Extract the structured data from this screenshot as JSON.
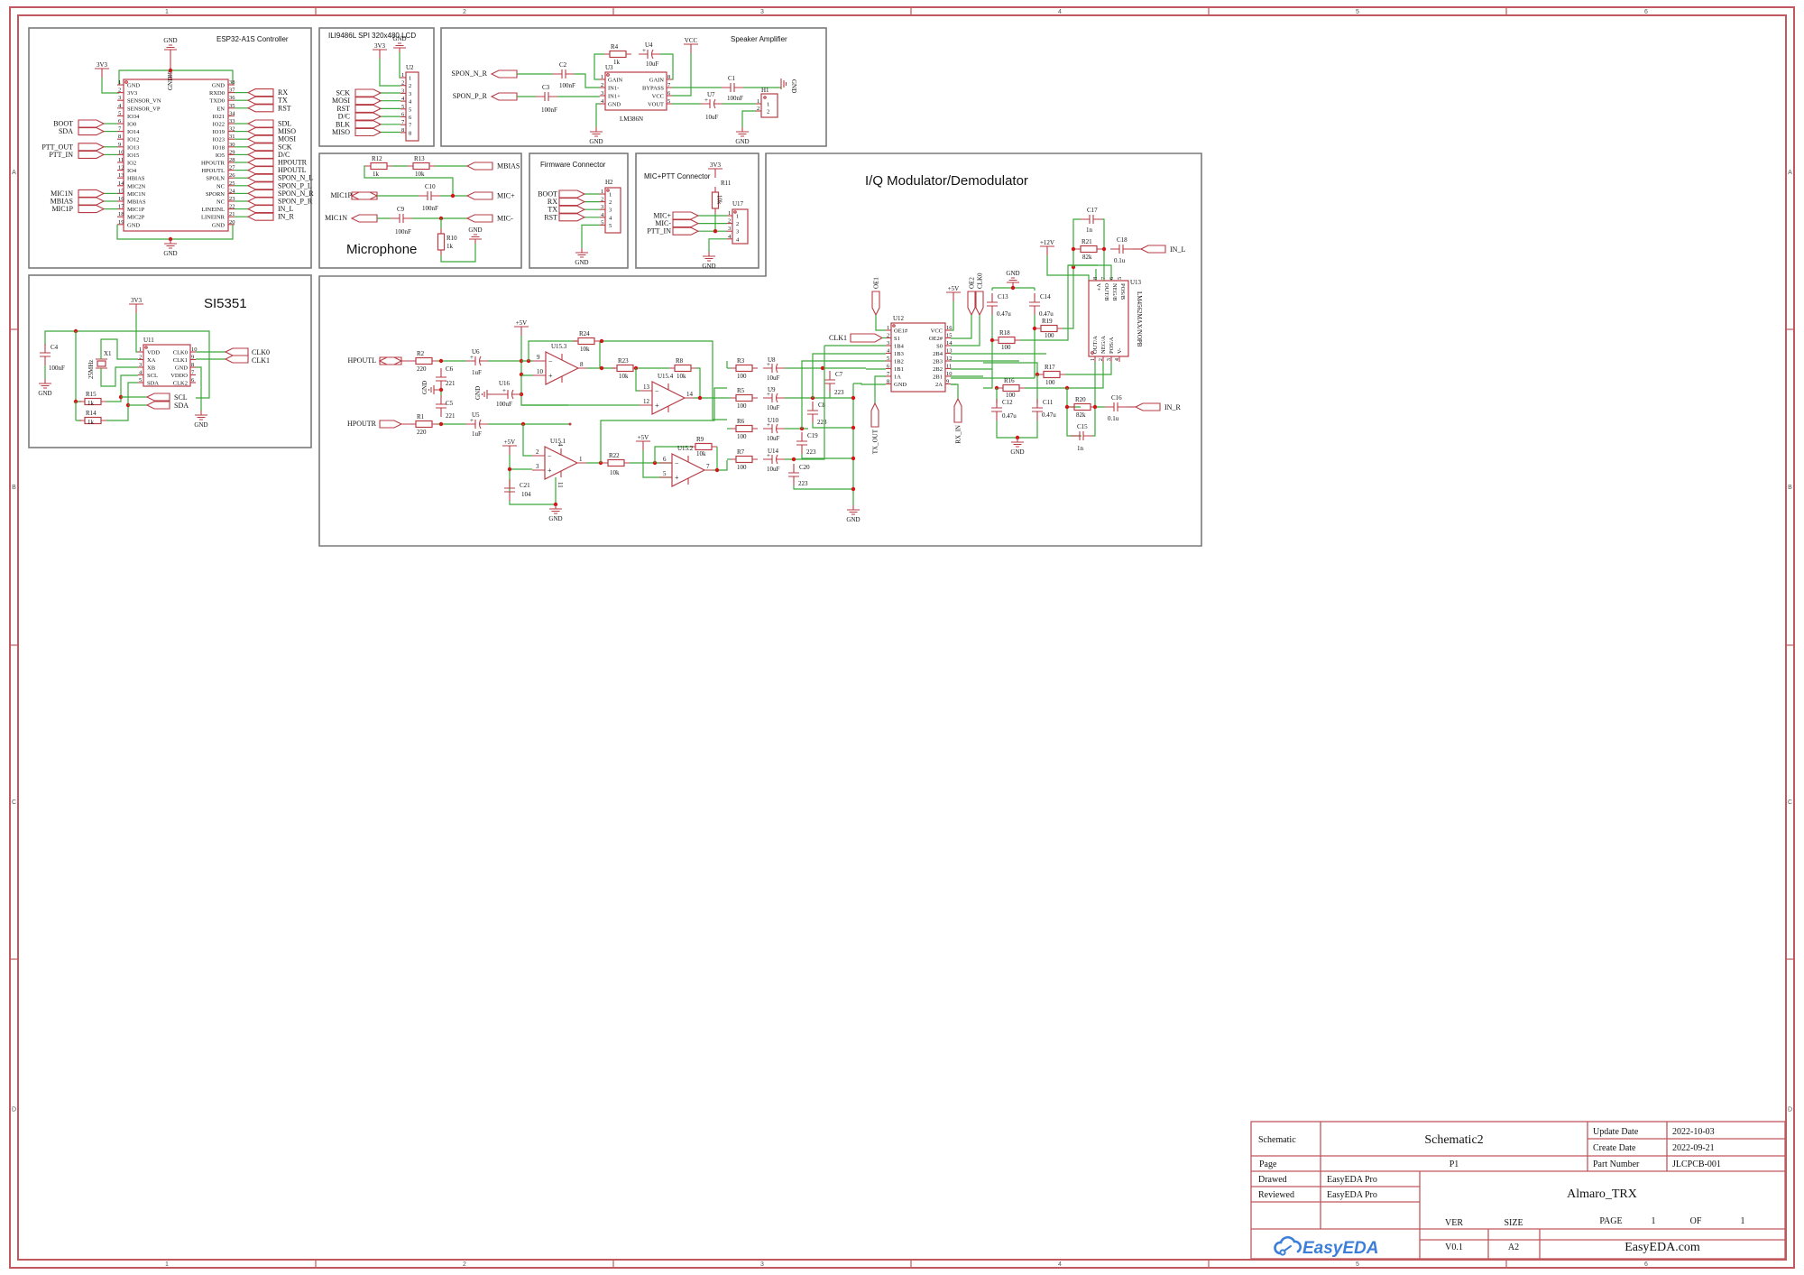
{
  "grid": {
    "columns": [
      "1",
      "2",
      "3",
      "4",
      "5",
      "6"
    ],
    "rows": [
      "A",
      "B",
      "C",
      "D"
    ]
  },
  "colors": {
    "wire": "#3aa83a",
    "component": "#b83c44",
    "junction": "#d01818",
    "frame": "#c0585d",
    "region_border": "#7a7a7a",
    "logo": "#3d7fd8"
  },
  "esp32": {
    "title": "ESP32-A1S Controller",
    "power_3v3": "3V3",
    "gnd_top": "GND",
    "gnd_bottom": "GND",
    "top_pin": {
      "num": "39",
      "name": "GND"
    },
    "left_pins": [
      {
        "num": "1",
        "name": "GND",
        "net": ""
      },
      {
        "num": "2",
        "name": "3V3",
        "net": ""
      },
      {
        "num": "3",
        "name": "SENSOR_VN",
        "net": ""
      },
      {
        "num": "4",
        "name": "SENSOR_VP",
        "net": ""
      },
      {
        "num": "5",
        "name": "IO34",
        "net": ""
      },
      {
        "num": "6",
        "name": "IO0",
        "net": "BOOT"
      },
      {
        "num": "7",
        "name": "IO14",
        "net": "SDA"
      },
      {
        "num": "8",
        "name": "IO12",
        "net": ""
      },
      {
        "num": "9",
        "name": "IO13",
        "net": "PTT_OUT"
      },
      {
        "num": "10",
        "name": "IO15",
        "net": "PTT_IN"
      },
      {
        "num": "11",
        "name": "IO2",
        "net": ""
      },
      {
        "num": "12",
        "name": "IO4",
        "net": ""
      },
      {
        "num": "13",
        "name": "HBIAS",
        "net": ""
      },
      {
        "num": "14",
        "name": "MIC2N",
        "net": ""
      },
      {
        "num": "15",
        "name": "MIC1N",
        "net": "MIC1N"
      },
      {
        "num": "16",
        "name": "MBIAS",
        "net": "MBIAS"
      },
      {
        "num": "17",
        "name": "MIC1P",
        "net": "MIC1P"
      },
      {
        "num": "18",
        "name": "MIC2P",
        "net": ""
      },
      {
        "num": "19",
        "name": "GND",
        "net": ""
      }
    ],
    "right_pins": [
      {
        "num": "38",
        "name": "GND",
        "net": ""
      },
      {
        "num": "37",
        "name": "RXD0",
        "net": "RX"
      },
      {
        "num": "36",
        "name": "TXD0",
        "net": "TX"
      },
      {
        "num": "35",
        "name": "EN",
        "net": "RST"
      },
      {
        "num": "34",
        "name": "IO21",
        "net": ""
      },
      {
        "num": "33",
        "name": "IO22",
        "net": "SDL"
      },
      {
        "num": "32",
        "name": "IO19",
        "net": "MISO"
      },
      {
        "num": "31",
        "name": "IO23",
        "net": "MOSI"
      },
      {
        "num": "30",
        "name": "IO18",
        "net": "SCK"
      },
      {
        "num": "29",
        "name": "IO5",
        "net": "D/C"
      },
      {
        "num": "28",
        "name": "HPOUTR",
        "net": "HPOUTR"
      },
      {
        "num": "27",
        "name": "HPOUTL",
        "net": "HPOUTL"
      },
      {
        "num": "26",
        "name": "SPOLN",
        "net": "SPON_N_L"
      },
      {
        "num": "25",
        "name": "NC",
        "net": "SPON_P_L"
      },
      {
        "num": "24",
        "name": "SPORN",
        "net": "SPON_N_R"
      },
      {
        "num": "23",
        "name": "NC",
        "net": "SPON_P_R"
      },
      {
        "num": "22",
        "name": "LINEINL",
        "net": "IN_L"
      },
      {
        "num": "21",
        "name": "LINEINR",
        "net": "IN_R"
      },
      {
        "num": "20",
        "name": "GND",
        "net": ""
      }
    ]
  },
  "lcd": {
    "title": "ILI9486L SPI 320x480 LCD",
    "power_3v3": "3V3",
    "gnd": "GND",
    "designator": "U2",
    "pins": [
      "1",
      "2",
      "3",
      "4",
      "5",
      "6",
      "7",
      "8"
    ],
    "nets": [
      "SCK",
      "MOSI",
      "RST",
      "D/C",
      "BLK",
      "MISO"
    ]
  },
  "speaker": {
    "title": "Speaker Amplifier",
    "vcc": "VCC",
    "gnd_right": "GND",
    "gnd_left": "GND",
    "gnd_h1": "GND",
    "in_n": "SPON_N_R",
    "in_p": "SPON_P_R",
    "r4": {
      "ref": "R4",
      "value": "1k"
    },
    "u4": {
      "ref": "U4",
      "value": "10uF"
    },
    "c2": {
      "ref": "C2",
      "value": "100nF"
    },
    "c3": {
      "ref": "C3",
      "value": "100nF"
    },
    "c1": {
      "ref": "C1",
      "value": "100nF"
    },
    "u7": {
      "ref": "U7",
      "value": "10uF"
    },
    "u3": {
      "ref": "U3",
      "part": "LM386N",
      "left_pins": [
        {
          "num": "1",
          "name": "GAIN"
        },
        {
          "num": "2",
          "name": "IN1-"
        },
        {
          "num": "3",
          "name": "IN1+"
        },
        {
          "num": "4",
          "name": "GND"
        }
      ],
      "right_pins": [
        {
          "num": "8",
          "name": "GAIN"
        },
        {
          "num": "7",
          "name": "BYPASS"
        },
        {
          "num": "6",
          "name": "VCC"
        },
        {
          "num": "5",
          "name": "VOUT"
        }
      ]
    },
    "h1": {
      "ref": "H1",
      "pins": [
        "1",
        "2"
      ]
    }
  },
  "microphone": {
    "title": "Microphone",
    "r12": {
      "ref": "R12",
      "value": "1k"
    },
    "r13": {
      "ref": "R13",
      "value": "10k"
    },
    "c10": {
      "ref": "C10",
      "value": "100nF"
    },
    "c9": {
      "ref": "C9",
      "value": "100nF"
    },
    "r10": {
      "ref": "R10",
      "value": "1k"
    },
    "gnd": "GND",
    "nets": {
      "mbias": "MBIAS",
      "mic1p": "MIC1P",
      "micp": "MIC+",
      "mic1n": "MIC1N",
      "micn": "MIC-"
    }
  },
  "firmware": {
    "title": "Firmware Connector",
    "designator": "H2",
    "pins": [
      "1",
      "2",
      "3",
      "4",
      "5"
    ],
    "nets": [
      "BOOT",
      "RX",
      "TX",
      "RST"
    ],
    "gnd": "GND"
  },
  "micptt": {
    "title": "MIC+PTT Connector",
    "power_3v3": "3V3",
    "r11": {
      "ref": "R11",
      "value": "10k"
    },
    "designator": "U17",
    "pins": [
      "1",
      "2",
      "3",
      "4"
    ],
    "nets": [
      "MIC+",
      "MIC-",
      "PTT_IN"
    ],
    "gnd": "GND"
  },
  "si5351": {
    "title": "SI5351",
    "power_3v3": "3V3",
    "designator": "U11",
    "left_pins": [
      {
        "num": "1",
        "name": "VDD"
      },
      {
        "num": "2",
        "name": "XA"
      },
      {
        "num": "3",
        "name": "XB"
      },
      {
        "num": "4",
        "name": "SCL"
      },
      {
        "num": "5",
        "name": "SDA"
      }
    ],
    "right_pins": [
      {
        "num": "10",
        "name": "CLK0"
      },
      {
        "num": "9",
        "name": "CLK1"
      },
      {
        "num": "8",
        "name": "GND"
      },
      {
        "num": "7",
        "name": "VDDO"
      },
      {
        "num": "6",
        "name": "CLK2"
      }
    ],
    "c4": {
      "ref": "C4",
      "value": "100nF"
    },
    "x1": {
      "ref": "X1",
      "value": "25MHz"
    },
    "r15": {
      "ref": "R15",
      "value": "1k"
    },
    "r14": {
      "ref": "R14",
      "value": "1k"
    },
    "nets": {
      "clk0": "CLK0",
      "clk1": "CLK1",
      "scl": "SCL",
      "sda": "SDA"
    },
    "gnd_c4": "GND",
    "gnd_chip": "GND"
  },
  "iq": {
    "title": "I/Q Modulator/Demodulator",
    "hpoutl": "HPOUTL",
    "hpoutr": "HPOUTR",
    "r2": {
      "ref": "R2",
      "value": "220"
    },
    "r1": {
      "ref": "R1",
      "value": "220"
    },
    "c6": {
      "ref": "C6",
      "value": "221"
    },
    "c5": {
      "ref": "C5",
      "value": "221"
    },
    "u6": {
      "ref": "U6",
      "value": "1uF"
    },
    "u5": {
      "ref": "U5",
      "value": "1uF"
    },
    "u16": {
      "ref": "U16",
      "value": "100uF"
    },
    "gnd_c": "GND",
    "gnd_u16": "GND",
    "p5v_a": "+5V",
    "p5v_b": "+5V",
    "p5v_c": "+5V",
    "p5v_d": "+5V",
    "p12v": "+12V",
    "u15_3": {
      "ref": "U15.3",
      "pins": [
        "9",
        "10",
        "8"
      ]
    },
    "u15_4": {
      "ref": "U15.4",
      "pins": [
        "13",
        "12",
        "14"
      ]
    },
    "u15_1": {
      "ref": "U15.1",
      "pins": [
        "2",
        "3",
        "1",
        "4",
        "11"
      ]
    },
    "u15_2": {
      "ref": "U15.2",
      "pins": [
        "6",
        "5",
        "7"
      ]
    },
    "r24": {
      "ref": "R24",
      "value": "10k"
    },
    "r23": {
      "ref": "R23",
      "value": "10k"
    },
    "r8": {
      "ref": "R8",
      "value": "10k"
    },
    "r22": {
      "ref": "R22",
      "value": "10k"
    },
    "r9": {
      "ref": "R9",
      "value": "10k"
    },
    "c21": {
      "ref": "C21",
      "value": "104"
    },
    "gnd_u15": "GND",
    "r3": {
      "ref": "R3",
      "value": "100"
    },
    "r5": {
      "ref": "R5",
      "value": "100"
    },
    "r6": {
      "ref": "R6",
      "value": "100"
    },
    "r7": {
      "ref": "R7",
      "value": "100"
    },
    "u8": {
      "ref": "U8",
      "value": "10uF"
    },
    "u9": {
      "ref": "U9",
      "value": "10uF"
    },
    "u10": {
      "ref": "U10",
      "value": "10uF"
    },
    "u14": {
      "ref": "U14",
      "value": "10uF"
    },
    "c7": {
      "ref": "C7",
      "value": "223"
    },
    "c8": {
      "ref": "C8",
      "value": "223"
    },
    "c19": {
      "ref": "C19",
      "value": "223"
    },
    "c20": {
      "ref": "C20",
      "value": "223"
    },
    "gnd_caps": "GND",
    "oe1": "OE1",
    "clk1": "CLK1",
    "oe2": "OE2",
    "clk0": "CLK0",
    "tx_out": "TX_OUT",
    "rx_in": "RX_IN",
    "u12": {
      "ref": "U12",
      "left_pins": [
        {
          "num": "1",
          "name": "OE1#"
        },
        {
          "num": "2",
          "name": "S1"
        },
        {
          "num": "3",
          "name": "1B4"
        },
        {
          "num": "4",
          "name": "1B3"
        },
        {
          "num": "5",
          "name": "1B2"
        },
        {
          "num": "6",
          "name": "1B1"
        },
        {
          "num": "7",
          "name": "1A"
        },
        {
          "num": "8",
          "name": "GND"
        }
      ],
      "right_pins": [
        {
          "num": "16",
          "name": "VCC"
        },
        {
          "num": "15",
          "name": "OE2#"
        },
        {
          "num": "14",
          "name": "S0"
        },
        {
          "num": "13",
          "name": "2B4"
        },
        {
          "num": "12",
          "name": "2B3"
        },
        {
          "num": "11",
          "name": "2B2"
        },
        {
          "num": "10",
          "name": "2B1"
        },
        {
          "num": "9",
          "name": "2A"
        }
      ]
    },
    "gnd_top": "GND",
    "gnd_bot": "GND",
    "c13": {
      "ref": "C13",
      "value": "0.47u"
    },
    "c14": {
      "ref": "C14",
      "value": "0.47u"
    },
    "c12": {
      "ref": "C12",
      "value": "0.47u"
    },
    "c11": {
      "ref": "C11",
      "value": "0.47u"
    },
    "r18": {
      "ref": "R18",
      "value": "100"
    },
    "r19": {
      "ref": "R19",
      "value": "100"
    },
    "r16": {
      "ref": "R16",
      "value": "100"
    },
    "r17": {
      "ref": "R17",
      "value": "100"
    },
    "c17": {
      "ref": "C17",
      "value": "1n"
    },
    "c15": {
      "ref": "C15",
      "value": "1n"
    },
    "r21": {
      "ref": "R21",
      "value": "82k"
    },
    "r20": {
      "ref": "R20",
      "value": "82k"
    },
    "c18": {
      "ref": "C18",
      "value": "0.1u"
    },
    "c16": {
      "ref": "C16",
      "value": "0.1u"
    },
    "in_l": "IN_L",
    "in_r": "IN_R",
    "u13": {
      "ref": "U13",
      "part": "LM4562MAX/NOPB",
      "top_pins": [
        {
          "num": "8",
          "name": "V+"
        },
        {
          "num": "7",
          "name": "OUT/B"
        },
        {
          "num": "6",
          "name": "NEG/B"
        },
        {
          "num": "5",
          "name": "POS/B"
        }
      ],
      "bottom_pins": [
        {
          "num": "1",
          "name": "OUT/A"
        },
        {
          "num": "2",
          "name": "NEG/A"
        },
        {
          "num": "3",
          "name": "POS/A"
        },
        {
          "num": "4",
          "name": "V-"
        }
      ]
    }
  },
  "title_block": {
    "schematic_label": "Schematic",
    "schematic_value": "Schematic2",
    "page_label": "Page",
    "page_value": "P1",
    "update_date_label": "Update Date",
    "update_date": "2022-10-03",
    "create_date_label": "Create Date",
    "create_date": "2022-09-21",
    "part_number_label": "Part Number",
    "part_number": "JLCPCB-001",
    "drawed_label": "Drawed",
    "drawed_value": "EasyEDA Pro",
    "reviewed_label": "Reviewed",
    "reviewed_value": "EasyEDA Pro",
    "project": "Almaro_TRX",
    "ver_label": "VER",
    "ver_value": "V0.1",
    "size_label": "SIZE",
    "size_value": "A2",
    "page_of_label": "PAGE",
    "page_num": "1",
    "of_label": "OF",
    "page_total": "1",
    "logo_text": "EasyEDA",
    "site": "EasyEDA.com"
  }
}
